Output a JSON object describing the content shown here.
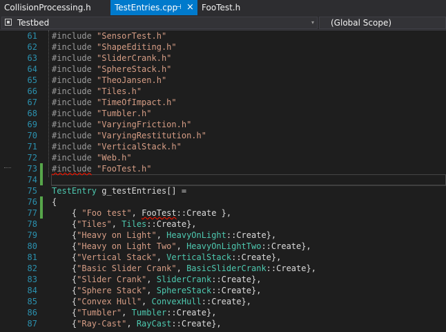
{
  "tabs": [
    {
      "label": "CollisionProcessing.h"
    },
    {
      "label": "TestEntries.cpp",
      "pin": "⊣",
      "close": "×"
    },
    {
      "label": "FooTest.h"
    }
  ],
  "nav": {
    "project": "Testbed",
    "scope": "(Global Scope)",
    "arrow": "▾"
  },
  "code_lines": [
    {
      "n": "61",
      "segs": [
        {
          "c": "pre",
          "t": "#include "
        },
        {
          "c": "str",
          "t": "\"SensorTest.h\""
        }
      ]
    },
    {
      "n": "62",
      "segs": [
        {
          "c": "pre",
          "t": "#include "
        },
        {
          "c": "str",
          "t": "\"ShapeEditing.h\""
        }
      ]
    },
    {
      "n": "63",
      "segs": [
        {
          "c": "pre",
          "t": "#include "
        },
        {
          "c": "str",
          "t": "\"SliderCrank.h\""
        }
      ]
    },
    {
      "n": "64",
      "segs": [
        {
          "c": "pre",
          "t": "#include "
        },
        {
          "c": "str",
          "t": "\"SphereStack.h\""
        }
      ]
    },
    {
      "n": "65",
      "segs": [
        {
          "c": "pre",
          "t": "#include "
        },
        {
          "c": "str",
          "t": "\"TheoJansen.h\""
        }
      ]
    },
    {
      "n": "66",
      "segs": [
        {
          "c": "pre",
          "t": "#include "
        },
        {
          "c": "str",
          "t": "\"Tiles.h\""
        }
      ]
    },
    {
      "n": "67",
      "segs": [
        {
          "c": "pre",
          "t": "#include "
        },
        {
          "c": "str",
          "t": "\"TimeOfImpact.h\""
        }
      ]
    },
    {
      "n": "68",
      "segs": [
        {
          "c": "pre",
          "t": "#include "
        },
        {
          "c": "str",
          "t": "\"Tumbler.h\""
        }
      ]
    },
    {
      "n": "69",
      "segs": [
        {
          "c": "pre",
          "t": "#include "
        },
        {
          "c": "str",
          "t": "\"VaryingFriction.h\""
        }
      ]
    },
    {
      "n": "70",
      "segs": [
        {
          "c": "pre",
          "t": "#include "
        },
        {
          "c": "str",
          "t": "\"VaryingRestitution.h\""
        }
      ]
    },
    {
      "n": "71",
      "segs": [
        {
          "c": "pre",
          "t": "#include "
        },
        {
          "c": "str",
          "t": "\"VerticalStack.h\""
        }
      ]
    },
    {
      "n": "72",
      "segs": [
        {
          "c": "pre",
          "t": "#include "
        },
        {
          "c": "str",
          "t": "\"Web.h\""
        }
      ]
    },
    {
      "n": "73",
      "changed": true,
      "segs": [
        {
          "c": "pre squig",
          "t": "#include"
        },
        {
          "c": "pre",
          "t": " "
        },
        {
          "c": "str",
          "t": "\"FooTest.h\""
        }
      ]
    },
    {
      "n": "74",
      "changed": true,
      "segs": []
    },
    {
      "n": "75",
      "segs": [
        {
          "c": "typ",
          "t": "TestEntry"
        },
        {
          "c": "txt",
          "t": " g_testEntries[] ="
        }
      ]
    },
    {
      "n": "76",
      "changed": true,
      "segs": [
        {
          "c": "txt",
          "t": "{"
        }
      ]
    },
    {
      "n": "77",
      "changed": true,
      "segs": [
        {
          "c": "txt",
          "t": "    { "
        },
        {
          "c": "str",
          "t": "\"Foo test\""
        },
        {
          "c": "txt",
          "t": ", "
        },
        {
          "c": "txt squig",
          "t": "FooTest"
        },
        {
          "c": "txt",
          "t": "::Create },"
        }
      ]
    },
    {
      "n": "78",
      "segs": [
        {
          "c": "txt",
          "t": "    {"
        },
        {
          "c": "str",
          "t": "\"Tiles\""
        },
        {
          "c": "txt",
          "t": ", "
        },
        {
          "c": "typ",
          "t": "Tiles"
        },
        {
          "c": "txt",
          "t": "::Create},"
        }
      ]
    },
    {
      "n": "79",
      "segs": [
        {
          "c": "txt",
          "t": "    {"
        },
        {
          "c": "str",
          "t": "\"Heavy on Light\""
        },
        {
          "c": "txt",
          "t": ", "
        },
        {
          "c": "typ",
          "t": "HeavyOnLight"
        },
        {
          "c": "txt",
          "t": "::Create},"
        }
      ]
    },
    {
      "n": "80",
      "segs": [
        {
          "c": "txt",
          "t": "    {"
        },
        {
          "c": "str",
          "t": "\"Heavy on Light Two\""
        },
        {
          "c": "txt",
          "t": ", "
        },
        {
          "c": "typ",
          "t": "HeavyOnLightTwo"
        },
        {
          "c": "txt",
          "t": "::Create},"
        }
      ]
    },
    {
      "n": "81",
      "segs": [
        {
          "c": "txt",
          "t": "    {"
        },
        {
          "c": "str",
          "t": "\"Vertical Stack\""
        },
        {
          "c": "txt",
          "t": ", "
        },
        {
          "c": "typ",
          "t": "VerticalStack"
        },
        {
          "c": "txt",
          "t": "::Create},"
        }
      ]
    },
    {
      "n": "82",
      "segs": [
        {
          "c": "txt",
          "t": "    {"
        },
        {
          "c": "str",
          "t": "\"Basic Slider Crank\""
        },
        {
          "c": "txt",
          "t": ", "
        },
        {
          "c": "typ",
          "t": "BasicSliderCrank"
        },
        {
          "c": "txt",
          "t": "::Create},"
        }
      ]
    },
    {
      "n": "83",
      "segs": [
        {
          "c": "txt",
          "t": "    {"
        },
        {
          "c": "str",
          "t": "\"Slider Crank\""
        },
        {
          "c": "txt",
          "t": ", "
        },
        {
          "c": "typ",
          "t": "SliderCrank"
        },
        {
          "c": "txt",
          "t": "::Create},"
        }
      ]
    },
    {
      "n": "84",
      "segs": [
        {
          "c": "txt",
          "t": "    {"
        },
        {
          "c": "str",
          "t": "\"Sphere Stack\""
        },
        {
          "c": "txt",
          "t": ", "
        },
        {
          "c": "typ",
          "t": "SphereStack"
        },
        {
          "c": "txt",
          "t": "::Create},"
        }
      ]
    },
    {
      "n": "85",
      "segs": [
        {
          "c": "txt",
          "t": "    {"
        },
        {
          "c": "str",
          "t": "\"Convex Hull\""
        },
        {
          "c": "txt",
          "t": ", "
        },
        {
          "c": "typ",
          "t": "ConvexHull"
        },
        {
          "c": "txt",
          "t": "::Create},"
        }
      ]
    },
    {
      "n": "86",
      "segs": [
        {
          "c": "txt",
          "t": "    {"
        },
        {
          "c": "str",
          "t": "\"Tumbler\""
        },
        {
          "c": "txt",
          "t": ", "
        },
        {
          "c": "typ",
          "t": "Tumbler"
        },
        {
          "c": "txt",
          "t": "::Create},"
        }
      ]
    },
    {
      "n": "87",
      "segs": [
        {
          "c": "txt",
          "t": "    {"
        },
        {
          "c": "str",
          "t": "\"Ray-Cast\""
        },
        {
          "c": "txt",
          "t": ", "
        },
        {
          "c": "typ",
          "t": "RayCast"
        },
        {
          "c": "txt",
          "t": "::Create},"
        }
      ]
    }
  ]
}
